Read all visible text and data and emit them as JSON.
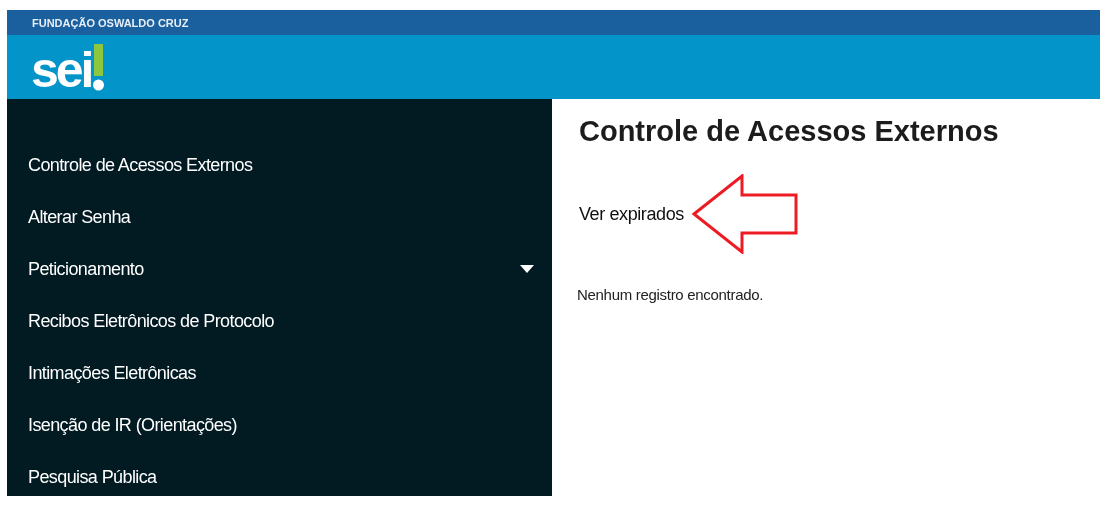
{
  "header": {
    "organization": "FUNDAÇÃO OSWALDO CRUZ",
    "logo_text": "sei"
  },
  "sidebar": {
    "items": [
      {
        "label": "Controle de Acessos Externos",
        "kind": "link"
      },
      {
        "label": "Alterar Senha",
        "kind": "link"
      },
      {
        "label": "Peticionamento",
        "kind": "submenu"
      },
      {
        "label": "Recibos Eletrônicos de Protocolo",
        "kind": "link"
      },
      {
        "label": "Intimações Eletrônicas",
        "kind": "link"
      },
      {
        "label": "Isenção de IR (Orientações)",
        "kind": "link"
      },
      {
        "label": "Pesquisa Pública",
        "kind": "link"
      }
    ]
  },
  "main": {
    "title": "Controle de Acessos Externos",
    "link": "Ver expirados",
    "annotation": {
      "kind": "arrow"
    },
    "message": "Nenhum registro encontrado."
  }
}
